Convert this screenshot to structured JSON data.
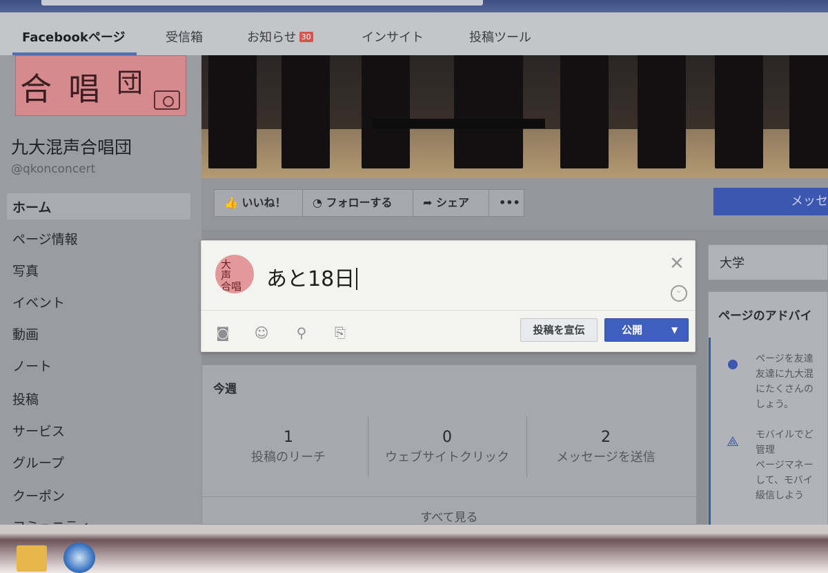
{
  "nav": {
    "tabs": [
      {
        "label": "Facebookページ"
      },
      {
        "label": "受信箱"
      },
      {
        "label": "お知らせ",
        "badge": "30"
      },
      {
        "label": "インサイト"
      },
      {
        "label": "投稿ツール"
      }
    ]
  },
  "page": {
    "name": "九大混声合唱団",
    "handle": "@qkonconcert",
    "logo_text": "合唱団"
  },
  "sidebar": {
    "items": [
      {
        "label": "ホーム"
      },
      {
        "label": "ページ情報"
      },
      {
        "label": "写真"
      },
      {
        "label": "イベント"
      },
      {
        "label": "動画"
      },
      {
        "label": "ノート"
      },
      {
        "label": "投稿"
      },
      {
        "label": "サービス"
      },
      {
        "label": "グループ"
      },
      {
        "label": "クーポン"
      },
      {
        "label": "コミュニティ"
      }
    ]
  },
  "actions": {
    "like": "いいね！",
    "follow": "フォローする",
    "share": "シェア",
    "more": "•••",
    "message": "メッセ"
  },
  "composer": {
    "avatar_lines": [
      "大",
      "声",
      "合唱"
    ],
    "text": "あと18日",
    "promote": "投稿を宣伝",
    "publish": "公開"
  },
  "weekly": {
    "title": "今週",
    "stats": [
      {
        "value": "1",
        "label": "投稿のリーチ"
      },
      {
        "value": "0",
        "label": "ウェブサイトクリック"
      },
      {
        "value": "2",
        "label": "メッセージを送信"
      }
    ],
    "see_all": "すべて見る"
  },
  "right": {
    "category": "大学",
    "advice_title": "ページのアドバイ",
    "advice_items": [
      {
        "lines": [
          "ページを友達",
          "友達に九大混",
          "にたくさんの",
          "しょう。"
        ]
      },
      {
        "lines": [
          "モバイルでど",
          "管理",
          "ページマネー",
          "して、モバイ",
          "級信しよう"
        ]
      }
    ]
  }
}
